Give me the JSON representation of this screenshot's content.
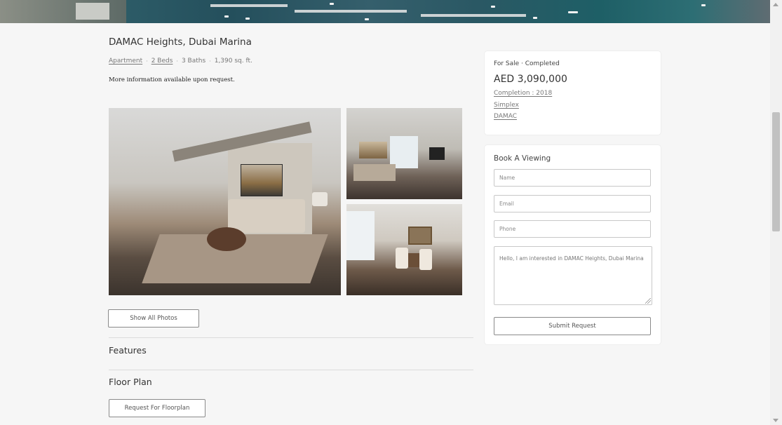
{
  "listing": {
    "title": "DAMAC Heights, Dubai Marina",
    "meta": {
      "type": "Apartment",
      "beds": "2 Beds",
      "baths": "3 Baths",
      "area": "1,390 sq. ft.",
      "separator": "·"
    },
    "description": "More information available upon request."
  },
  "gallery": {
    "show_all_label": "Show All Photos"
  },
  "sections": {
    "features_title": "Features",
    "floor_plan_title": "Floor Plan",
    "floorplan_button": "Request For Floorplan"
  },
  "sale_card": {
    "status": "For Sale · Completed",
    "price": "AED 3,090,000",
    "completion": "Completion : 2018",
    "layout": "Simplex",
    "developer": "DAMAC"
  },
  "booking": {
    "heading": "Book A Viewing",
    "name_placeholder": "Name",
    "email_placeholder": "Email",
    "phone_placeholder": "Phone",
    "message_value": "Hello, I am interested in DAMAC Heights, Dubai Marina",
    "submit_label": "Submit Request"
  }
}
